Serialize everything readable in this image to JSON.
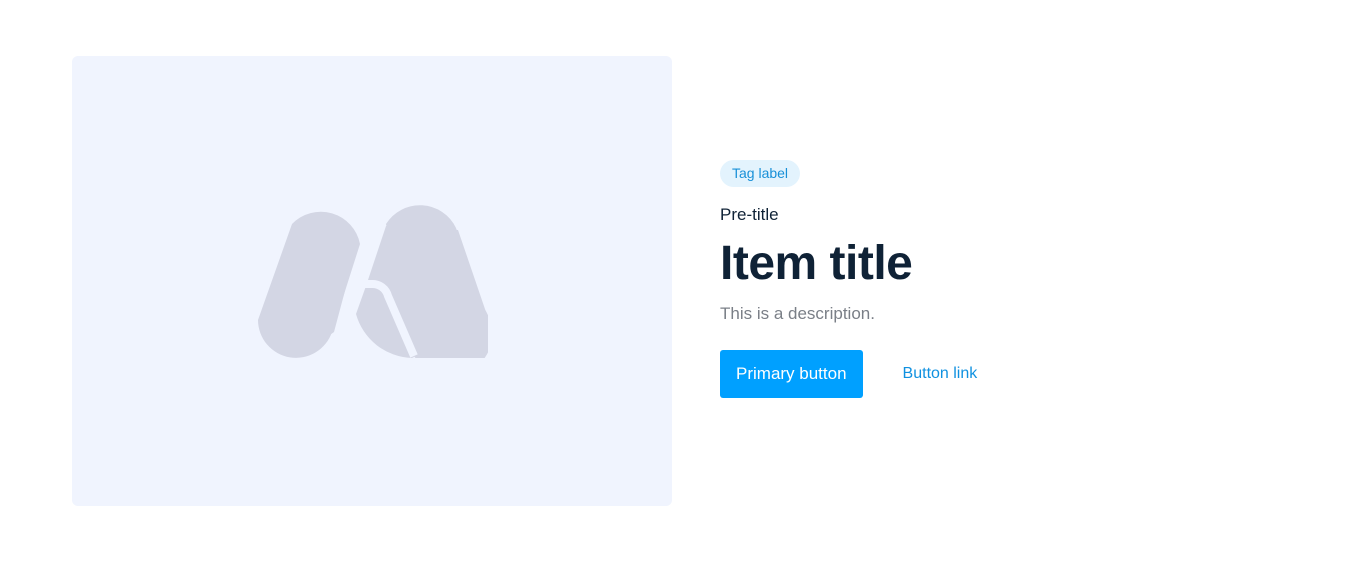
{
  "card": {
    "tag_label": "Tag label",
    "pretitle": "Pre-title",
    "title": "Item title",
    "description": "This is a description.",
    "primary_button_label": "Primary button",
    "link_button_label": "Button link"
  },
  "media": {
    "icon": "placeholder-logo-icon"
  },
  "colors": {
    "media_background": "#f0f4fe",
    "logo": "#d3d6e4",
    "tag_background": "#e3f3fd",
    "tag_text": "#1890d8",
    "title": "#0f2236",
    "description": "#7a7f87",
    "primary": "#00a0ff",
    "link": "#1091e0"
  }
}
